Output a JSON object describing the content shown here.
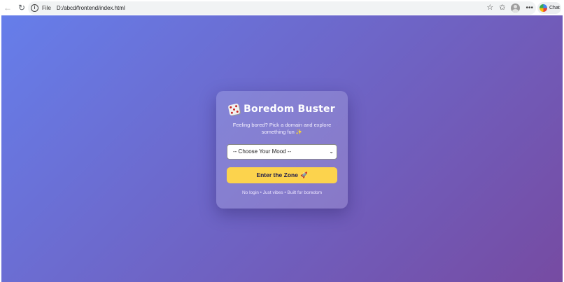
{
  "browser": {
    "address_scheme_label": "File",
    "url": "D:/abcd/frontend/index.html",
    "chat_label": "Chat"
  },
  "card": {
    "title": "Boredom Buster",
    "subtitle": "Feeling bored? Pick a domain and explore something fun ✨",
    "select": {
      "selected_value": "-- Choose Your Mood --"
    },
    "enter_button_label": "Enter the Zone",
    "enter_button_icon": "rocket-icon",
    "footer": "No login • Just vibes • Built for boredom"
  },
  "colors": {
    "gradient_start": "#667eea",
    "gradient_end": "#764ba2",
    "button_bg": "#fcd34d"
  }
}
